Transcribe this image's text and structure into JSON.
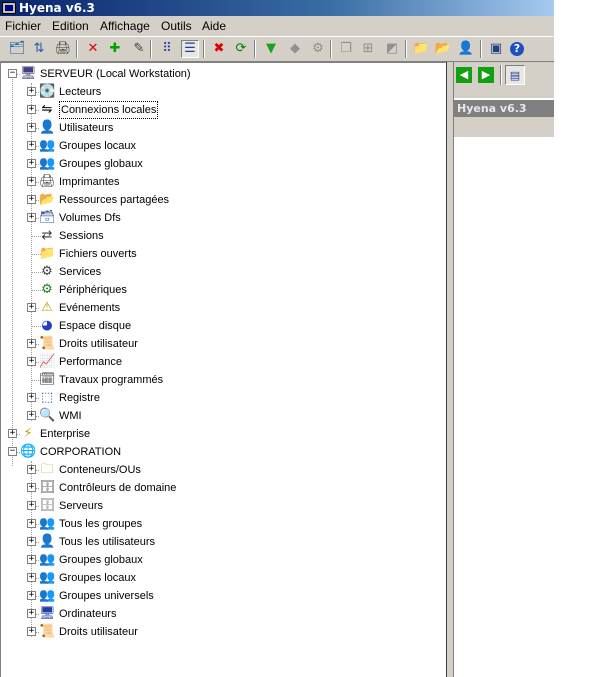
{
  "window": {
    "title": "Hyena v6.3"
  },
  "menu": [
    "Fichier",
    "Edition",
    "Affichage",
    "Outils",
    "Aide"
  ],
  "toolbar": {
    "buttons": [
      {
        "name": "tree-icon",
        "glyph": "🗂",
        "color": "#2060a0"
      },
      {
        "name": "refresh-tree-icon",
        "glyph": "⇅",
        "color": "#2060a0"
      },
      {
        "name": "printer-icon",
        "glyph": "🖨",
        "color": "#404040"
      },
      {
        "name": "delete-icon",
        "glyph": "✕",
        "color": "#e00000"
      },
      {
        "name": "add-icon",
        "glyph": "✚",
        "color": "#00a000"
      },
      {
        "name": "properties-icon",
        "glyph": "✎",
        "color": "#404040"
      },
      {
        "name": "small-icons-view-icon",
        "glyph": "⠿",
        "color": "#2040a0"
      },
      {
        "name": "details-view-icon",
        "glyph": "☰",
        "color": "#2040a0"
      },
      {
        "name": "stop-icon",
        "glyph": "✖",
        "color": "#e00000"
      },
      {
        "name": "refresh-icon",
        "glyph": "⟳",
        "color": "#008000"
      },
      {
        "name": "filter-icon",
        "glyph": "▼",
        "color": "#20a020"
      },
      {
        "name": "disabled-tool-icon",
        "glyph": "◆",
        "color": "#909090"
      },
      {
        "name": "disabled-connect-icon",
        "glyph": "⚙",
        "color": "#909090"
      },
      {
        "name": "disabled-copy-icon",
        "glyph": "❐",
        "color": "#909090"
      },
      {
        "name": "disabled-network-icon",
        "glyph": "⊞",
        "color": "#909090"
      },
      {
        "name": "disabled-page-icon",
        "glyph": "◩",
        "color": "#909090"
      },
      {
        "name": "folder-user-icon",
        "glyph": "📁",
        "color": "#c0a000"
      },
      {
        "name": "user-folder-red-icon",
        "glyph": "📂",
        "color": "#c04000"
      },
      {
        "name": "user-key-icon",
        "glyph": "👤",
        "color": "#a00040"
      },
      {
        "name": "console-icon",
        "glyph": "▣",
        "color": "#204080"
      },
      {
        "name": "help-icon",
        "glyph": "?",
        "color": "#ffffff"
      }
    ]
  },
  "right_toolbar": [
    {
      "name": "back-icon",
      "glyph": "◀"
    },
    {
      "name": "forward-icon",
      "glyph": "▶"
    },
    {
      "name": "list-icon",
      "glyph": "▤"
    }
  ],
  "right_panel": {
    "title": "Hyena v6.3"
  },
  "tree": [
    {
      "label": "SERVEUR (Local Workstation)",
      "icon": "computer-icon",
      "glyph": "🖥",
      "color": "#404080",
      "level": 0,
      "expander": "−"
    },
    {
      "label": "Lecteurs",
      "icon": "drive-icon",
      "glyph": "💽",
      "color": "#606060",
      "level": 1,
      "expander": "+"
    },
    {
      "label": "Connexions locales",
      "icon": "connection-icon",
      "glyph": "⇋",
      "color": "#000000",
      "level": 1,
      "expander": "+",
      "selected": true
    },
    {
      "label": "Utilisateurs",
      "icon": "user-icon",
      "glyph": "👤",
      "color": "#203040",
      "level": 1,
      "expander": "+"
    },
    {
      "label": "Groupes locaux",
      "icon": "local-groups-icon",
      "glyph": "👥",
      "color": "#203060",
      "level": 1,
      "expander": "+"
    },
    {
      "label": "Groupes globaux",
      "icon": "global-groups-icon",
      "glyph": "👥",
      "color": "#205060",
      "level": 1,
      "expander": "+"
    },
    {
      "label": "Imprimantes",
      "icon": "printer-icon",
      "glyph": "🖨",
      "color": "#404040",
      "level": 1,
      "expander": "+"
    },
    {
      "label": "Ressources partagées",
      "icon": "shared-folder-icon",
      "glyph": "📂",
      "color": "#c0a000",
      "level": 1,
      "expander": "+"
    },
    {
      "label": "Volumes Dfs",
      "icon": "dfs-volume-icon",
      "glyph": "🗃",
      "color": "#4060a0",
      "level": 1,
      "expander": "+"
    },
    {
      "label": "Sessions",
      "icon": "sessions-icon",
      "glyph": "⇄",
      "color": "#404040",
      "level": 1,
      "expander": ""
    },
    {
      "label": "Fichiers ouverts",
      "icon": "folder-icon",
      "glyph": "📁",
      "color": "#c0a000",
      "level": 1,
      "expander": ""
    },
    {
      "label": "Services",
      "icon": "gears-icon",
      "glyph": "⚙",
      "color": "#404040",
      "level": 1,
      "expander": ""
    },
    {
      "label": "Périphériques",
      "icon": "device-icon",
      "glyph": "⚙",
      "color": "#208020",
      "level": 1,
      "expander": ""
    },
    {
      "label": "Evénements",
      "icon": "warning-icon",
      "glyph": "⚠",
      "color": "#c0a000",
      "level": 1,
      "expander": "+"
    },
    {
      "label": "Espace disque",
      "icon": "disk-space-icon",
      "glyph": "◕",
      "color": "#2040c0",
      "level": 1,
      "expander": ""
    },
    {
      "label": "Droits utilisateur",
      "icon": "scroll-icon",
      "glyph": "📜",
      "color": "#a08020",
      "level": 1,
      "expander": "+"
    },
    {
      "label": "Performance",
      "icon": "performance-icon",
      "glyph": "📈",
      "color": "#c04040",
      "level": 1,
      "expander": "+"
    },
    {
      "label": "Travaux programmés",
      "icon": "scheduled-task-icon",
      "glyph": "🗓",
      "color": "#404040",
      "level": 1,
      "expander": ""
    },
    {
      "label": "Registre",
      "icon": "registry-icon",
      "glyph": "⬚",
      "color": "#2060a0",
      "level": 1,
      "expander": "+"
    },
    {
      "label": "WMI",
      "icon": "wmi-icon",
      "glyph": "🔍",
      "color": "#404040",
      "level": 1,
      "expander": "+"
    },
    {
      "label": "Enterprise",
      "icon": "enterprise-icon",
      "glyph": "⚡",
      "color": "#c0a000",
      "level": 0,
      "expander": "+"
    },
    {
      "label": "CORPORATION",
      "icon": "globe-icon",
      "glyph": "🌐",
      "color": "#208040",
      "level": 0,
      "expander": "−"
    },
    {
      "label": "Conteneurs/OUs",
      "icon": "container-icon",
      "glyph": "🗀",
      "color": "#c0a000",
      "level": 1,
      "expander": "+"
    },
    {
      "label": "Contrôleurs de domaine",
      "icon": "domain-controller-icon",
      "glyph": "🗄",
      "color": "#606060",
      "level": 1,
      "expander": "+"
    },
    {
      "label": "Serveurs",
      "icon": "server-icon",
      "glyph": "🗄",
      "color": "#808080",
      "level": 1,
      "expander": "+"
    },
    {
      "label": "Tous les groupes",
      "icon": "all-groups-icon",
      "glyph": "👥",
      "color": "#203040",
      "level": 1,
      "expander": "+"
    },
    {
      "label": "Tous les utilisateurs",
      "icon": "all-users-icon",
      "glyph": "👤",
      "color": "#203040",
      "level": 1,
      "expander": "+"
    },
    {
      "label": "Groupes globaux",
      "icon": "global-groups-icon",
      "glyph": "👥",
      "color": "#205060",
      "level": 1,
      "expander": "+"
    },
    {
      "label": "Groupes locaux",
      "icon": "local-groups-icon",
      "glyph": "👥",
      "color": "#203060",
      "level": 1,
      "expander": "+"
    },
    {
      "label": "Groupes universels",
      "icon": "universal-groups-icon",
      "glyph": "👥",
      "color": "#203040",
      "level": 1,
      "expander": "+"
    },
    {
      "label": "Ordinateurs",
      "icon": "computer-icon",
      "glyph": "🖥",
      "color": "#2040a0",
      "level": 1,
      "expander": "+"
    },
    {
      "label": "Droits utilisateur",
      "icon": "scroll-icon",
      "glyph": "📜",
      "color": "#a08020",
      "level": 1,
      "expander": "+"
    }
  ]
}
